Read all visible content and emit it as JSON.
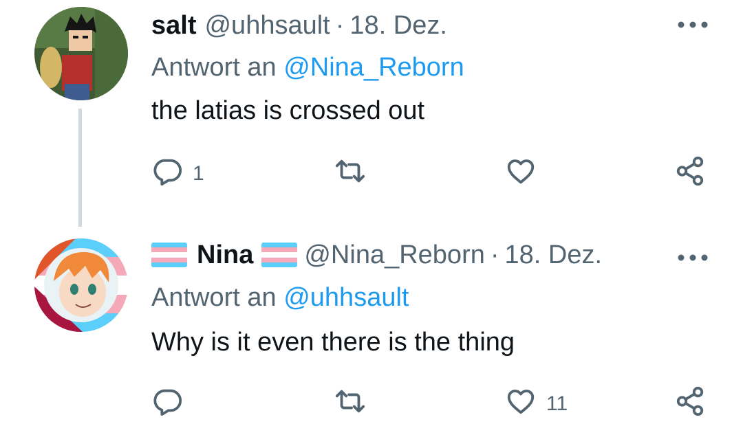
{
  "tweets": [
    {
      "display_name": "salt",
      "handle": "@uhhsault",
      "date": "18. Dez.",
      "reply_prefix": "Antwort an",
      "reply_to": "@Nina_Reborn",
      "text": "the latias is crossed out",
      "reply_count": "1",
      "retweet_count": "",
      "like_count": ""
    },
    {
      "display_name": "Nina",
      "handle": "@Nina_Reborn",
      "date": "18. Dez.",
      "reply_prefix": "Antwort an",
      "reply_to": "@uhhsault",
      "text": "Why is it even there is the thing",
      "reply_count": "",
      "retweet_count": "",
      "like_count": "11"
    }
  ],
  "separator": "·",
  "icons": {
    "reply": "speech-bubble-icon",
    "retweet": "retweet-icon",
    "like": "heart-icon",
    "share": "share-icon",
    "more": "more-dots-icon",
    "flag": "trans-flag-emoji"
  },
  "colors": {
    "text_primary": "#0f1419",
    "text_secondary": "#536471",
    "link": "#1d9bf0",
    "thread_line": "#cfd9de"
  }
}
